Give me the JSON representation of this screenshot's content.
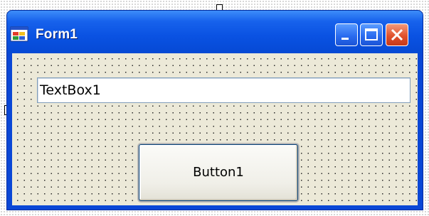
{
  "window": {
    "title": "Form1",
    "icon": "form-app-icon",
    "controls": {
      "minimize_icon": "minimize-icon",
      "maximize_icon": "maximize-icon",
      "close_icon": "close-icon"
    }
  },
  "form": {
    "textbox_value": "TextBox1",
    "button_label": "Button1"
  },
  "colors": {
    "titlebar": "#0a52e2",
    "client_area": "#ece9d8",
    "close_button": "#e1522d"
  }
}
